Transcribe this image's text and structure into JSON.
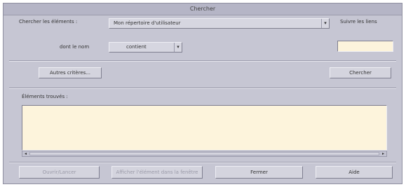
{
  "window": {
    "title": "Chercher"
  },
  "search": {
    "in_label": "Chercher les éléments :",
    "in_value": "Mon répertoire d'utilisateur",
    "follow_links_label": "Suivre les liens",
    "name_label": "dont le nom",
    "name_op_value": "contient",
    "name_value": ""
  },
  "buttons": {
    "more_criteria": "Autres critères...",
    "search": "Chercher",
    "open": "Ouvrir/Lancer",
    "open_parent": "Afficher l'élément dans la fenêtre",
    "close": "Fermer",
    "help": "Aide"
  },
  "results": {
    "label": "Éléments trouvés :"
  },
  "icons": {
    "combo_arrow": "chevron-down-icon",
    "scroll_left": "arrow-left-icon",
    "scroll_right": "arrow-right-icon"
  }
}
